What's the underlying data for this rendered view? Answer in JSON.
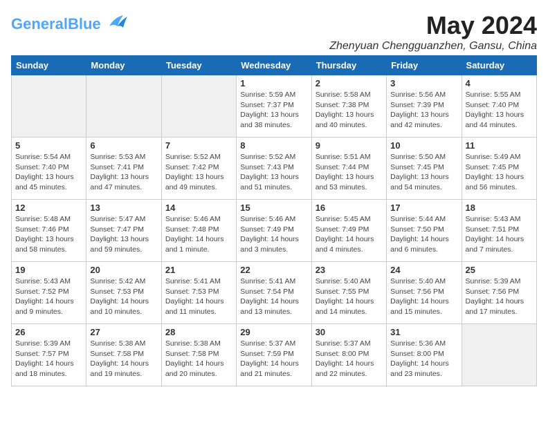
{
  "logo": {
    "text_general": "General",
    "text_blue": "Blue"
  },
  "title": "May 2024",
  "subtitle": "Zhenyuan Chengguanzhen, Gansu, China",
  "weekdays": [
    "Sunday",
    "Monday",
    "Tuesday",
    "Wednesday",
    "Thursday",
    "Friday",
    "Saturday"
  ],
  "weeks": [
    [
      {
        "day": "",
        "info": ""
      },
      {
        "day": "",
        "info": ""
      },
      {
        "day": "",
        "info": ""
      },
      {
        "day": "1",
        "info": "Sunrise: 5:59 AM\nSunset: 7:37 PM\nDaylight: 13 hours\nand 38 minutes."
      },
      {
        "day": "2",
        "info": "Sunrise: 5:58 AM\nSunset: 7:38 PM\nDaylight: 13 hours\nand 40 minutes."
      },
      {
        "day": "3",
        "info": "Sunrise: 5:56 AM\nSunset: 7:39 PM\nDaylight: 13 hours\nand 42 minutes."
      },
      {
        "day": "4",
        "info": "Sunrise: 5:55 AM\nSunset: 7:40 PM\nDaylight: 13 hours\nand 44 minutes."
      }
    ],
    [
      {
        "day": "5",
        "info": "Sunrise: 5:54 AM\nSunset: 7:40 PM\nDaylight: 13 hours\nand 45 minutes."
      },
      {
        "day": "6",
        "info": "Sunrise: 5:53 AM\nSunset: 7:41 PM\nDaylight: 13 hours\nand 47 minutes."
      },
      {
        "day": "7",
        "info": "Sunrise: 5:52 AM\nSunset: 7:42 PM\nDaylight: 13 hours\nand 49 minutes."
      },
      {
        "day": "8",
        "info": "Sunrise: 5:52 AM\nSunset: 7:43 PM\nDaylight: 13 hours\nand 51 minutes."
      },
      {
        "day": "9",
        "info": "Sunrise: 5:51 AM\nSunset: 7:44 PM\nDaylight: 13 hours\nand 53 minutes."
      },
      {
        "day": "10",
        "info": "Sunrise: 5:50 AM\nSunset: 7:45 PM\nDaylight: 13 hours\nand 54 minutes."
      },
      {
        "day": "11",
        "info": "Sunrise: 5:49 AM\nSunset: 7:45 PM\nDaylight: 13 hours\nand 56 minutes."
      }
    ],
    [
      {
        "day": "12",
        "info": "Sunrise: 5:48 AM\nSunset: 7:46 PM\nDaylight: 13 hours\nand 58 minutes."
      },
      {
        "day": "13",
        "info": "Sunrise: 5:47 AM\nSunset: 7:47 PM\nDaylight: 13 hours\nand 59 minutes."
      },
      {
        "day": "14",
        "info": "Sunrise: 5:46 AM\nSunset: 7:48 PM\nDaylight: 14 hours\nand 1 minute."
      },
      {
        "day": "15",
        "info": "Sunrise: 5:46 AM\nSunset: 7:49 PM\nDaylight: 14 hours\nand 3 minutes."
      },
      {
        "day": "16",
        "info": "Sunrise: 5:45 AM\nSunset: 7:49 PM\nDaylight: 14 hours\nand 4 minutes."
      },
      {
        "day": "17",
        "info": "Sunrise: 5:44 AM\nSunset: 7:50 PM\nDaylight: 14 hours\nand 6 minutes."
      },
      {
        "day": "18",
        "info": "Sunrise: 5:43 AM\nSunset: 7:51 PM\nDaylight: 14 hours\nand 7 minutes."
      }
    ],
    [
      {
        "day": "19",
        "info": "Sunrise: 5:43 AM\nSunset: 7:52 PM\nDaylight: 14 hours\nand 9 minutes."
      },
      {
        "day": "20",
        "info": "Sunrise: 5:42 AM\nSunset: 7:53 PM\nDaylight: 14 hours\nand 10 minutes."
      },
      {
        "day": "21",
        "info": "Sunrise: 5:41 AM\nSunset: 7:53 PM\nDaylight: 14 hours\nand 11 minutes."
      },
      {
        "day": "22",
        "info": "Sunrise: 5:41 AM\nSunset: 7:54 PM\nDaylight: 14 hours\nand 13 minutes."
      },
      {
        "day": "23",
        "info": "Sunrise: 5:40 AM\nSunset: 7:55 PM\nDaylight: 14 hours\nand 14 minutes."
      },
      {
        "day": "24",
        "info": "Sunrise: 5:40 AM\nSunset: 7:56 PM\nDaylight: 14 hours\nand 15 minutes."
      },
      {
        "day": "25",
        "info": "Sunrise: 5:39 AM\nSunset: 7:56 PM\nDaylight: 14 hours\nand 17 minutes."
      }
    ],
    [
      {
        "day": "26",
        "info": "Sunrise: 5:39 AM\nSunset: 7:57 PM\nDaylight: 14 hours\nand 18 minutes."
      },
      {
        "day": "27",
        "info": "Sunrise: 5:38 AM\nSunset: 7:58 PM\nDaylight: 14 hours\nand 19 minutes."
      },
      {
        "day": "28",
        "info": "Sunrise: 5:38 AM\nSunset: 7:58 PM\nDaylight: 14 hours\nand 20 minutes."
      },
      {
        "day": "29",
        "info": "Sunrise: 5:37 AM\nSunset: 7:59 PM\nDaylight: 14 hours\nand 21 minutes."
      },
      {
        "day": "30",
        "info": "Sunrise: 5:37 AM\nSunset: 8:00 PM\nDaylight: 14 hours\nand 22 minutes."
      },
      {
        "day": "31",
        "info": "Sunrise: 5:36 AM\nSunset: 8:00 PM\nDaylight: 14 hours\nand 23 minutes."
      },
      {
        "day": "",
        "info": ""
      }
    ]
  ]
}
